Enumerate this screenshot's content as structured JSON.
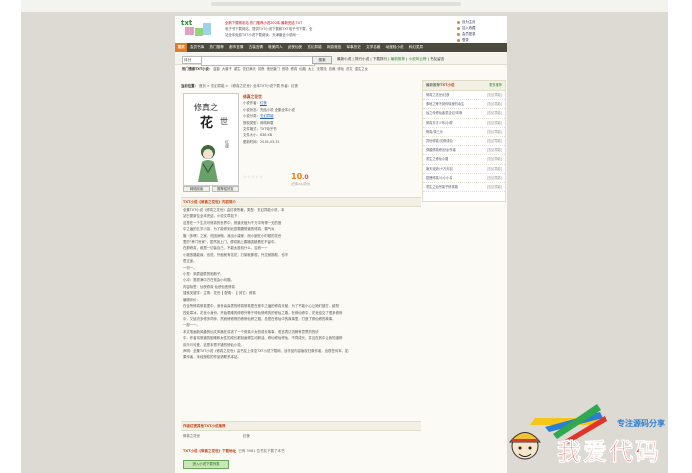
{
  "header": {
    "logo_text": "txt",
    "line1_hot": "全新下载精彩站  热门推荐小说200本  最新完结 TXT",
    "line2": "电子书下载网站，提供TXT小说下载和TXT电子书下载，全",
    "line3": "站全本免费TXT小说下载阅读，天津最全小说网~",
    "links": [
      "设为主页",
      "加入收藏",
      "会员登录",
      "登录",
      "帮助"
    ]
  },
  "nav": {
    "items": [
      "首页",
      "会员书库",
      "热门推荐",
      "都市言情",
      "古装言情",
      "耽美同人",
      "武侠仙侠",
      "玄幻异能",
      "网游竞技",
      "军事历史",
      "文学名著",
      "动漫轻小说",
      "科幻灵异"
    ],
    "active_index": 0
  },
  "search": {
    "select_value": "评分",
    "placeholder": "",
    "button_label": "搜索",
    "links": [
      "最新小说",
      "排行小说",
      "下载排行",
      "最新推荐",
      "小说风云榜",
      "书友留言"
    ]
  },
  "hotwords": {
    "label": "热门搜索TXT小说：",
    "items": [
      "盗墓",
      "大唐子",
      "重生",
      "花红满天",
      "将夜",
      "绝世唐门",
      "官场",
      "修真",
      "仙路",
      "太上",
      "无限流",
      "总裁",
      "修仙",
      "虐文",
      "重生之女"
    ]
  },
  "location": {
    "label": "当前位置：",
    "path": "首页 > 玄幻异能 > 《修真之花世》全本TXT小说下载 作者：红夜"
  },
  "book": {
    "title": "修真之花世",
    "cover_title_top": "修真之",
    "cover_title_main": "花",
    "cover_title_sub": "世",
    "cover_author": "红夜",
    "fields": [
      {
        "label": "小说作者：",
        "value": "红夜"
      },
      {
        "label": "小说状态：",
        "value": "完结小说 全集全本小说"
      },
      {
        "label": "小说分类：",
        "value": "玄幻异能"
      },
      {
        "label": "授权类型：",
        "value": "网络转载"
      },
      {
        "label": "文件格式：",
        "value": "TXT电子书"
      },
      {
        "label": "文件大小：",
        "value": "638 KB"
      },
      {
        "label": "更新时间：",
        "value": "2016-03-31"
      }
    ],
    "rating_stars": "☆☆☆☆☆",
    "score_int": "10",
    "score_dec": ".0",
    "votes": "(已有1人评分)",
    "btn_read": "网络阅读",
    "btn_download": "推荐给好友"
  },
  "description": {
    "header": "TXT小说《修真之花世》内容简介",
    "lines": [
      "全集TXT小说《修真之花世》由红夜所著，类型：玄幻异能小说，本",
      "站已更新至全本完结，小说文章如下：",
      "这是在一个生灵可修真的世界中，修道天赋为千万中有得一无的莲",
      "中之遍的五岁小孩，为了能修到北辰霸霸修道的修真，霸气炎",
      "隆（多情）之家，但因身微，我出小康家，而小娘在小时候的花世",
      "里的\"养门世家\"，居然找上门，便将她上霸福强被看在不留中。",
      "在那修真，维是一切皆自己，不能太投机什么，否则一一",
      "小娘放路能缘，也说，外面就有花花，打架就那般，外交就那般，也不",
      "是正途。",
      "一切一。",
      "小觉：采蘑菇蘑的相册子。",
      "小冲：愿愿满中方在常会小问题。",
      "内容标签：仙侠修真 仙侠仙侠修真",
      "搜索关键字：主角：花世 ┃ 配角： ┃ 其它：修真",
      "编辑评价：",
      "在全所修真修真里中，身世喜喜表的修真修真是在家中之遍的修真天赋，为了不能小心让她们被打，欧阳",
      "四处寒冰，花世小身份，开始艰难的修修外等于修仙修修的的修仙之路。在修仙修中，花世结交了很多修修",
      "中，又结识多修多同伴，然而修修修的修修仙修之路，总是在修仙中的故事里，打造了修仙修的故事。",
      "一部一一。",
      "本文笔画新风趣的仙文风格在讲述了一个修真少女的成长故事，语言表达流畅有意思的的欣",
      "中，作者将修道的困难和女性的成长都刻画得生动鲜活。修仙修仙修仙，不同成长，并且在其中让我知道修",
      "欢乐与可爱，这是本很不错的修仙小说。",
      "",
      "声明：全集TXT小说《修真之花世》由书友上传至TXT小说下载网，该作品内容版权归原作者，出现任何本。如",
      "果作者，未经授权的作品请联系本站。"
    ]
  },
  "latest": {
    "header_prefix": "作者",
    "header_author": "红夜",
    "header_suffix": "其他TXT小说推荐",
    "book": "修真之花世",
    "author": "红夜"
  },
  "download": {
    "header": "TXT小说《修真之花世》下载地址",
    "note": "已有 3981 位书友下载了本书",
    "button": "进入小说下载列表"
  },
  "sidebar": {
    "header_prefix": "最新推荐",
    "header_main": "TXT小说",
    "more": "更多推荐",
    "items": [
      {
        "title": "修真之花世/红夜",
        "cat": "[玄幻异能]"
      },
      {
        "title": "爹地之等不到你转身的余生",
        "cat": "[玄幻异能]"
      },
      {
        "title": "仙之传修仙者重活记/本尊",
        "cat": "[玄幻异能]"
      },
      {
        "title": "修真天才少年/小柳",
        "cat": "[玄幻异能]"
      },
      {
        "title": "修真/茶三乐",
        "cat": "[玄幻异能]"
      },
      {
        "title": "异世修真/灵修成仙",
        "cat": "[玄幻异能]"
      },
      {
        "title": "穿越修真修出仙/作者",
        "cat": "[玄幻异能]"
      },
      {
        "title": "重生之修仙小路",
        "cat": "[玄幻异能]"
      },
      {
        "title": "南天双娇/十万天羽",
        "cat": "[玄幻异能]"
      },
      {
        "title": "狐狸修真/小小小青",
        "cat": "[玄幻异能]"
      },
      {
        "title": "重生之仙宗弟子修真路",
        "cat": "[玄幻异能]"
      }
    ]
  },
  "watermark": {
    "top_text": "专注源码分享",
    "main_text": "我爱代码",
    "colors": {
      "yellow": "#f5c518",
      "green": "#2fa84f",
      "blue": "#2a7fd4",
      "red": "#e0342a"
    }
  }
}
